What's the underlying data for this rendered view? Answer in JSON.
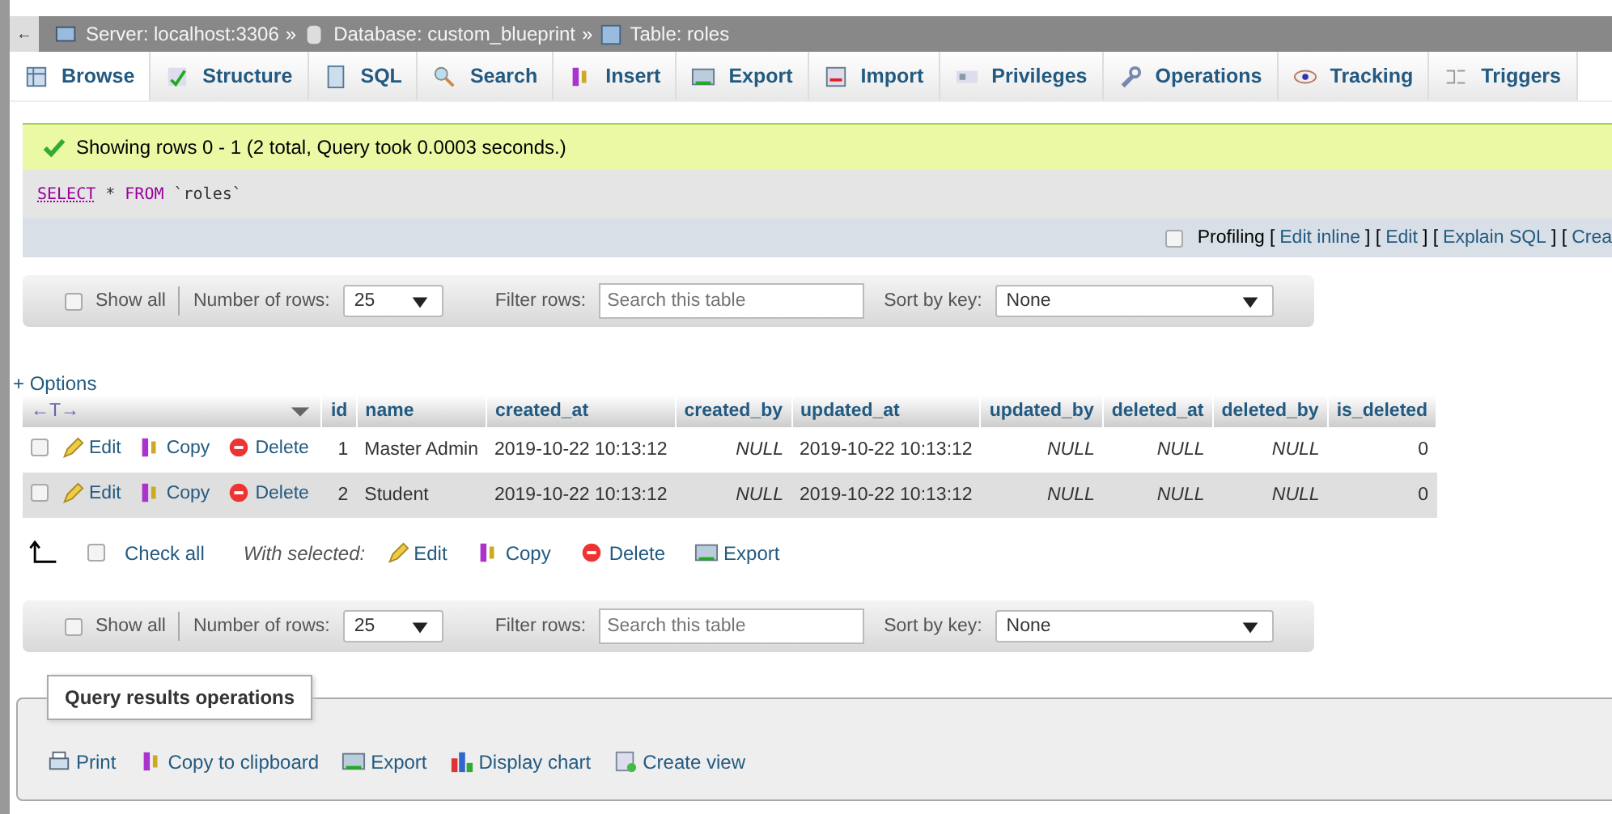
{
  "breadcrumb": [
    {
      "kind": "server",
      "label": "Server: localhost:3306"
    },
    {
      "kind": "database",
      "label": "Database: custom_blueprint"
    },
    {
      "kind": "table",
      "label": "Table: roles"
    }
  ],
  "breadcrumb_separator": "»",
  "back": "←",
  "tabs": [
    {
      "label": "Browse",
      "selected": true
    },
    {
      "label": "Structure",
      "selected": false
    },
    {
      "label": "SQL",
      "selected": false
    },
    {
      "label": "Search",
      "selected": false
    },
    {
      "label": "Insert",
      "selected": false
    },
    {
      "label": "Export",
      "selected": false
    },
    {
      "label": "Import",
      "selected": false
    },
    {
      "label": "Privileges",
      "selected": false
    },
    {
      "label": "Operations",
      "selected": false
    },
    {
      "label": "Tracking",
      "selected": false
    },
    {
      "label": "Triggers",
      "selected": false
    }
  ],
  "success": "Showing rows 0 - 1 (2 total, Query took 0.0003 seconds.)",
  "sql": {
    "keyword1": "SELECT",
    "star": "*",
    "keyword2": "FROM",
    "table": "`roles`"
  },
  "profiling": {
    "checked": false,
    "label": "Profiling",
    "parts": [
      {
        "kind": "text",
        "text": "["
      },
      {
        "kind": "link",
        "text": "Edit inline"
      },
      {
        "kind": "text",
        "text": "] ["
      },
      {
        "kind": "link",
        "text": "Edit"
      },
      {
        "kind": "text",
        "text": "] ["
      },
      {
        "kind": "link",
        "text": "Explain SQL"
      },
      {
        "kind": "text",
        "text": "] ["
      },
      {
        "kind": "link",
        "text": "Crea"
      }
    ]
  },
  "nav_bars": [
    {
      "show_all": "Show all",
      "show_all_checked": false,
      "rows_label": "Number of rows:",
      "rows": "25",
      "filter_label": "Filter rows:",
      "filter_placeholder": "Search this table",
      "sort_label": "Sort by key:",
      "sort": "None"
    },
    {
      "show_all": "Show all",
      "show_all_checked": false,
      "rows_label": "Number of rows:",
      "rows": "25",
      "filter_label": "Filter rows:",
      "filter_placeholder": "Search this table",
      "sort_label": "Sort by key:",
      "sort": "None"
    }
  ],
  "options": "+ Options",
  "arrows": "←T→",
  "table": {
    "columns": [
      "id",
      "name",
      "created_at",
      "created_by",
      "updated_at",
      "updated_by",
      "deleted_at",
      "deleted_by",
      "is_deleted"
    ],
    "rows": [
      {
        "checked": false,
        "actions": [
          "Edit",
          "Copy",
          "Delete"
        ],
        "cells": [
          "1",
          "Master Admin",
          "2019-10-22 10:13:12",
          "NULL",
          "2019-10-22 10:13:12",
          "NULL",
          "NULL",
          "NULL",
          "0"
        ]
      },
      {
        "checked": false,
        "actions": [
          "Edit",
          "Copy",
          "Delete"
        ],
        "cells": [
          "2",
          "Student",
          "2019-10-22 10:13:12",
          "NULL",
          "2019-10-22 10:13:12",
          "NULL",
          "NULL",
          "NULL",
          "0"
        ]
      }
    ]
  },
  "bulk": {
    "check_all": "Check all",
    "checked": false,
    "with_selected": "With selected:",
    "actions": [
      {
        "kind": "edit",
        "label": "Edit"
      },
      {
        "kind": "copy",
        "label": "Copy"
      },
      {
        "kind": "delete",
        "label": "Delete"
      },
      {
        "kind": "export",
        "label": "Export"
      }
    ]
  },
  "operations": {
    "legend": "Query results operations",
    "actions": [
      {
        "kind": "print",
        "label": "Print"
      },
      {
        "kind": "copy",
        "label": "Copy to clipboard"
      },
      {
        "kind": "export",
        "label": "Export"
      },
      {
        "kind": "chart",
        "label": "Display chart"
      },
      {
        "kind": "view",
        "label": "Create view"
      }
    ]
  }
}
